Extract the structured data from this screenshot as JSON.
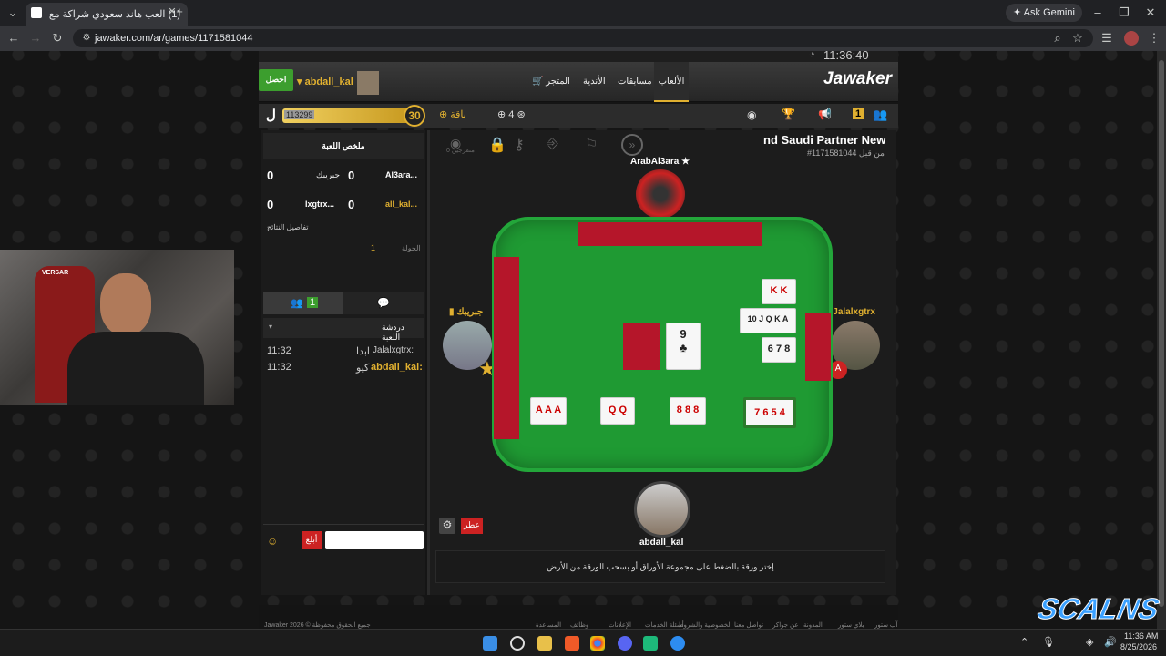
{
  "browser": {
    "tab_title": "(1) العب هاند سعودي شراكة مع",
    "url": "jawaker.com/ar/games/1171581044",
    "ask_gemini": "Ask Gemini"
  },
  "site": {
    "clock": "11:36:40",
    "logo": "Jawaker",
    "nav": [
      "الألعاب",
      "مسابقات",
      "الأندية",
      "المتجر"
    ],
    "user": "abdall_kal",
    "get_btn": "احصل"
  },
  "status": {
    "score": "113299",
    "level": "30",
    "count_chip": "4",
    "baqa": "باقة",
    "notif": "1"
  },
  "game": {
    "title": "nd Saudi Partner New",
    "id": "#1171581044 من قبل",
    "spectators": "0 متفرجين"
  },
  "summary": {
    "title": "ملخص اللعبة",
    "rows": [
      {
        "name": "Al3ara...",
        "score": "0",
        "name2": "جبريبك",
        "score2": "0"
      },
      {
        "name": "all_kal...",
        "score": "0",
        "name2": "lxgtrx...",
        "score2": "0"
      }
    ],
    "details": "تفاصيل النتائج",
    "round_label": "الجولة",
    "round": "1"
  },
  "chat": {
    "tab_count": "1",
    "header": "دردشة اللعبة",
    "messages": [
      {
        "user": "Jalalxgtrx:",
        "text": "ابدا",
        "time": "11:32"
      },
      {
        "user": "abdall_kal:",
        "text": "كيو",
        "time": "11:32"
      }
    ],
    "send": "أبلغ"
  },
  "players": {
    "top": "ArabAl3ara",
    "left": "جبريبك",
    "right": "Jalalxgtrx",
    "bottom": "abdall_kal"
  },
  "table_cards": {
    "center": "9",
    "right_cols": [
      "K K",
      "10 J Q K A",
      "6 7 8"
    ],
    "melds": [
      "A A A",
      "Q Q",
      "8 8 8",
      "7 6 5 4"
    ]
  },
  "actions": {
    "pass": "عطر",
    "instruction": "إختر ورقة بالضغط على مجموعة الأوراق أو بسحب الورقة من الأرض"
  },
  "footer": {
    "copy": "Jawaker 2026 © جميع الحقوق محفوظة",
    "links": [
      "المساعدة",
      "وظائف",
      "الإعلانات",
      "أسئلة الخدمات",
      "الخصوصية والشروط",
      "تواصل معنا",
      "عن جواكر",
      "المدونة",
      "بلاي ستور",
      "آب ستور"
    ]
  },
  "taskbar": {
    "time": "11:36 AM",
    "date": "8/25/2026"
  },
  "stream": {
    "logo": "SCALNS",
    "chair": "VERSAR"
  }
}
